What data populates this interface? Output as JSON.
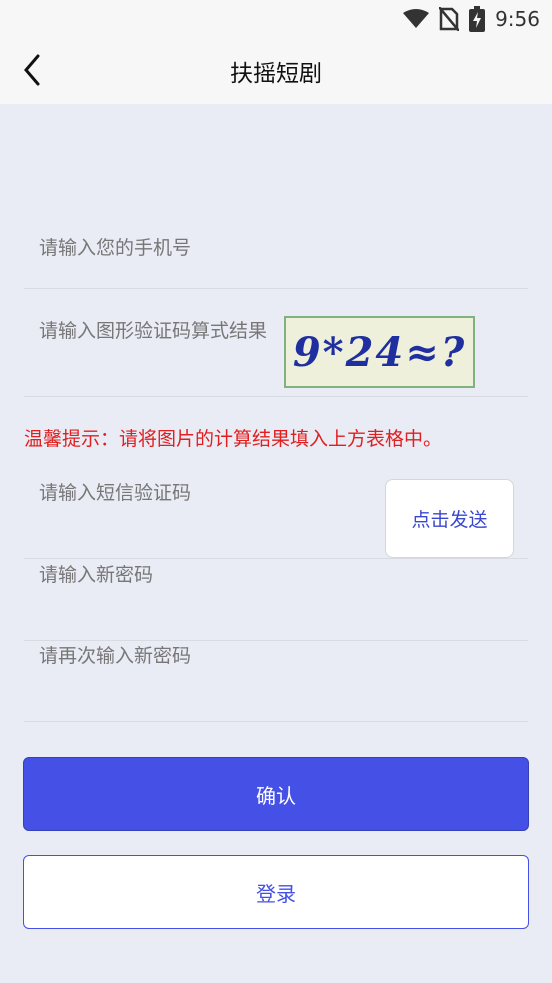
{
  "status_bar": {
    "time": "9:56",
    "icons": [
      "wifi-icon",
      "no-sim-icon",
      "battery-charging-icon"
    ]
  },
  "header": {
    "back_icon": "chevron-left-icon",
    "title": "扶摇短剧"
  },
  "form": {
    "phone_placeholder": "请输入您的手机号",
    "captcha_placeholder": "请输入图形验证码算式结果",
    "captcha_image_text": "9*24≈?",
    "tip": "温馨提示：请将图片的计算结果填入上方表格中。",
    "sms_placeholder": "请输入短信验证码",
    "send_button": "点击发送",
    "new_password_placeholder": "请输入新密码",
    "confirm_password_placeholder": "请再次输入新密码"
  },
  "actions": {
    "confirm_label": "确认",
    "login_label": "登录"
  },
  "colors": {
    "background": "#e9ebf5",
    "accent": "#4450e6",
    "tip": "#e02020"
  }
}
